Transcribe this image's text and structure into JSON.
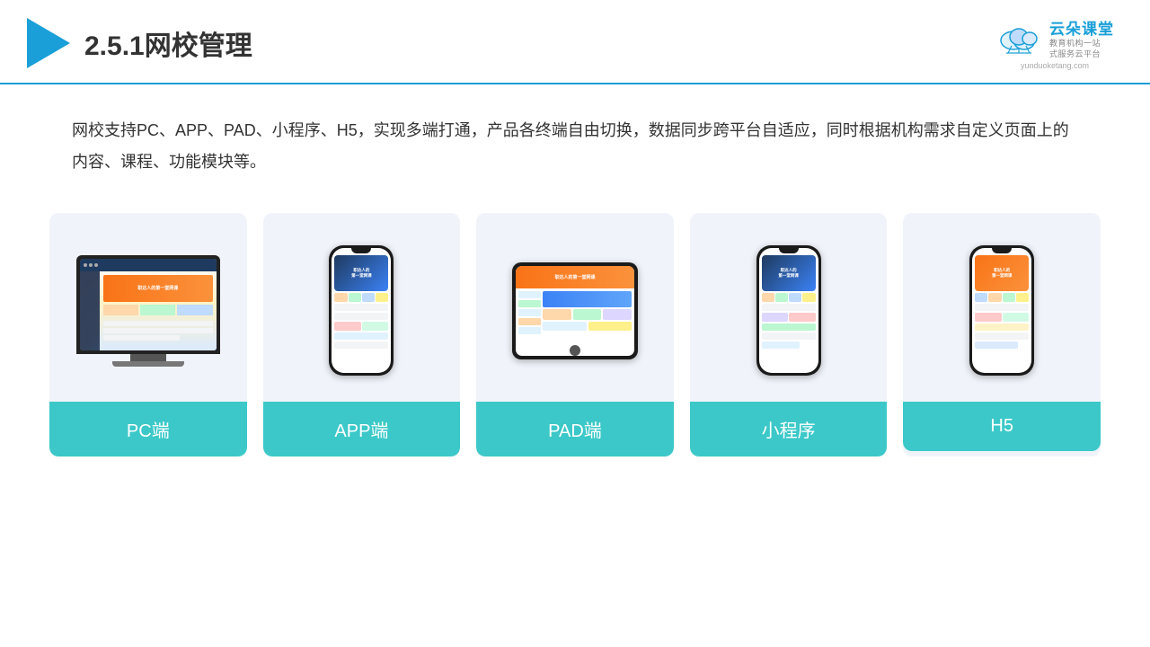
{
  "header": {
    "title": "2.5.1网校管理",
    "brand": {
      "name": "云朵课堂",
      "tagline_line1": "教育机构一站",
      "tagline_line2": "式服务云平台",
      "url": "yunduoketang.com"
    }
  },
  "description": {
    "text": "网校支持PC、APP、PAD、小程序、H5，实现多端打通，产品各终端自由切换，数据同步跨平台自适应，同时根据机构需求自定义页面上的内容、课程、功能模块等。"
  },
  "cards": [
    {
      "id": "pc",
      "label": "PC端"
    },
    {
      "id": "app",
      "label": "APP端"
    },
    {
      "id": "pad",
      "label": "PAD端"
    },
    {
      "id": "miniprogram",
      "label": "小程序"
    },
    {
      "id": "h5",
      "label": "H5"
    }
  ],
  "accent_color": "#3cc8c8",
  "brand_color": "#1a9fd8"
}
